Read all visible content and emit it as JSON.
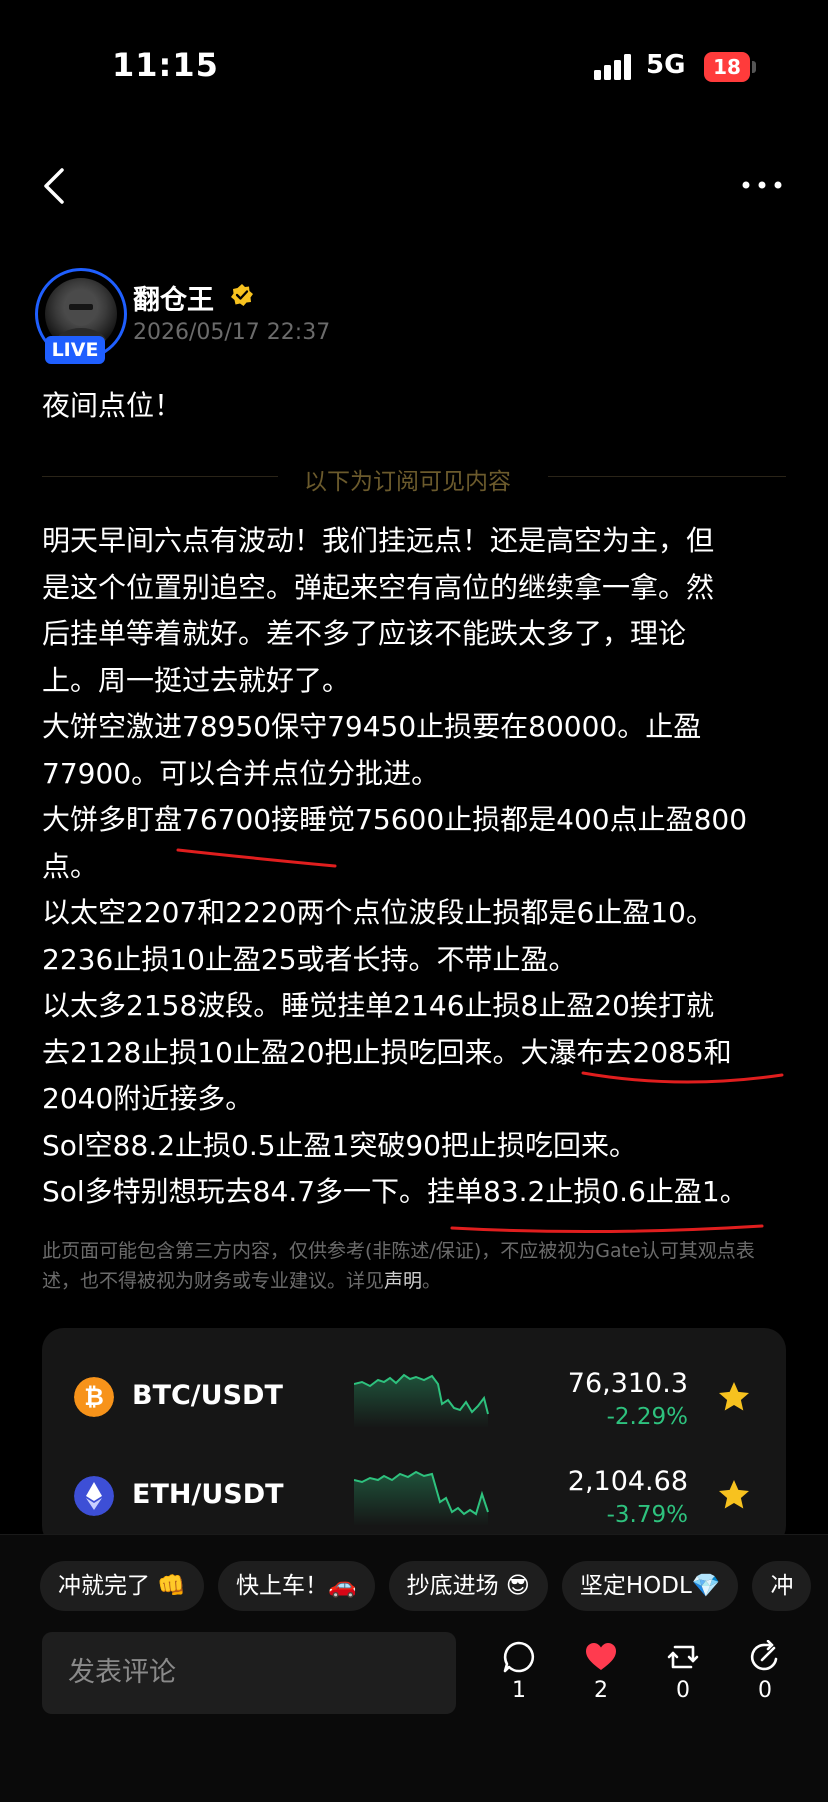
{
  "status_bar": {
    "time": "11:15",
    "network": "5G",
    "battery": "18"
  },
  "post": {
    "author": "翻仓王",
    "live_badge": "LIVE",
    "date": "2026/05/17 22:37",
    "title": "夜间点位！",
    "subscriber_divider": "以下为订阅可见内容",
    "lines": [
      "明天早间六点有波动！我们挂远点！还是高空为主，但",
      "是这个位置别追空。弹起来空有高位的继续拿一拿。然",
      "后挂单等着就好。差不多了应该不能跌太多了，理论",
      "上。周一挺过去就好了。",
      "大饼空激进78950保守79450止损要在80000。止盈",
      "77900。可以合并点位分批进。",
      "大饼多盯盘76700接睡觉75600止损都是400点止盈800",
      "点。",
      "以太空2207和2220两个点位波段止损都是6止盈10。",
      "2236止损10止盈25或者长持。不带止盈。",
      "以太多2158波段。睡觉挂单2146止损8止盈20挨打就",
      "去2128止损10止盈20把止损吃回来。大瀑布去2085和",
      "2040附近接多。",
      "Sol空88.2止损0.5止盈1突破90把止损吃回来。",
      "Sol多特别想玩去84.7多一下。挂单83.2止损0.6止盈1。"
    ],
    "disclaimer_text": "此页面可能包含第三方内容，仅供参考(非陈述/保证)，不应被视为Gate认可其观点表述，也不得被视为财务或专业建议。详见",
    "disclaimer_link": "声明",
    "disclaimer_end": "。"
  },
  "tickers": [
    {
      "pair": "BTC/USDT",
      "price": "76,310.3",
      "change": "-2.29%",
      "icon": "bitcoin-icon",
      "color": "#f7931a"
    },
    {
      "pair": "ETH/USDT",
      "price": "2,104.68",
      "change": "-3.79%",
      "icon": "ethereum-icon",
      "color": "#3d4fd6"
    }
  ],
  "quick_replies": [
    "冲就完了 👊",
    "快上车！🚗",
    "抄底进场 😎",
    "坚定HODL💎",
    "冲"
  ],
  "comment": {
    "placeholder": "发表评论"
  },
  "actions": {
    "comments": "1",
    "likes": "2",
    "reposts": "0",
    "shares": "0"
  },
  "colors": {
    "accent_blue": "#1f5fff",
    "gain_green": "#2ec27e",
    "like_red": "#ff3b4f",
    "star_gold": "#f7c21f",
    "underline_red": "#e01e1e"
  }
}
